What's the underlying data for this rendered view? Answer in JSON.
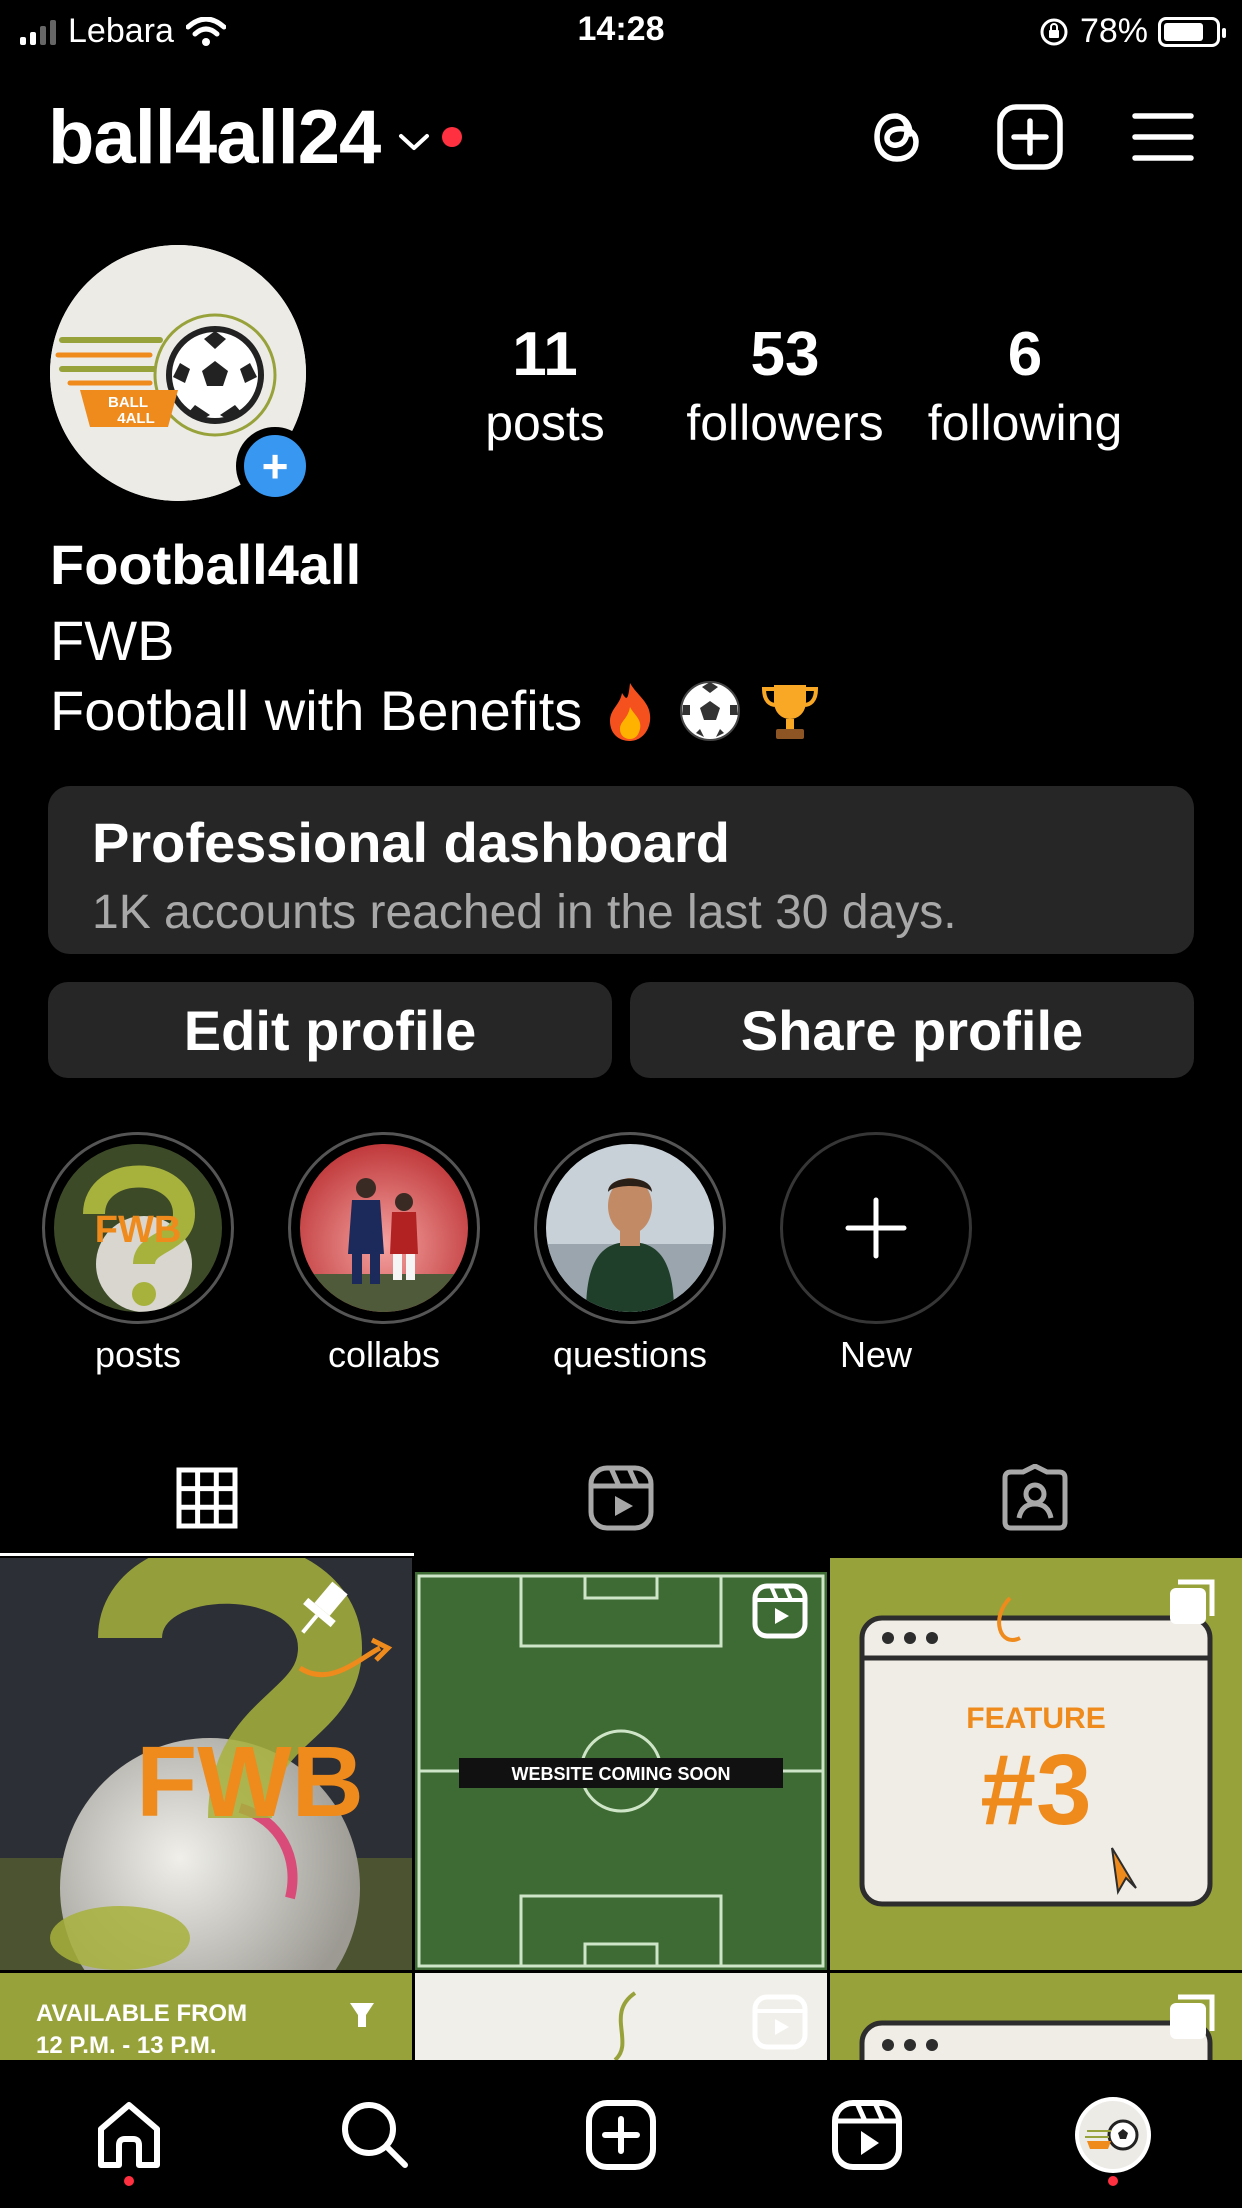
{
  "status_bar": {
    "carrier": "Lebara",
    "time": "14:28",
    "battery": "78%",
    "battery_level": 0.78,
    "icons": [
      "signal-icon",
      "wifi-icon",
      "orientation-lock-icon",
      "battery-icon"
    ]
  },
  "header": {
    "username": "ball4all24",
    "icons": [
      "chevron-down-icon",
      "threads-icon",
      "create-icon",
      "menu-icon"
    ],
    "notification_color": "#ff3040"
  },
  "profile": {
    "logo_text": [
      "BALL",
      "4ALL"
    ],
    "stats": [
      {
        "value": "11",
        "label": "posts"
      },
      {
        "value": "53",
        "label": "followers"
      },
      {
        "value": "6",
        "label": "following"
      }
    ],
    "name": "Football4all",
    "bio_line1": "FWB",
    "bio_line2": "Football with Benefits",
    "bio_emojis": [
      "fire-emoji",
      "soccer-ball-emoji",
      "trophy-emoji"
    ]
  },
  "dashboard": {
    "title": "Professional dashboard",
    "subtitle": "1K accounts reached in the last 30 days."
  },
  "buttons": {
    "edit": "Edit profile",
    "share": "Share profile"
  },
  "highlights": [
    {
      "label": "posts",
      "cover_text": "FWB"
    },
    {
      "label": "collabs"
    },
    {
      "label": "questions"
    },
    {
      "label": "New"
    }
  ],
  "tabs": [
    "grid-icon",
    "reels-icon",
    "tagged-icon"
  ],
  "grid": {
    "post1_text": "FWB",
    "post2_text": "WEBSITE COMING SOON",
    "post3_text_small": "FEATURE",
    "post3_text_big": "#3",
    "post4_text_line1": "AVAILABLE FROM",
    "post4_text_line2": "12 P.M. - 13 P.M."
  },
  "bottom_nav": [
    "home-icon",
    "search-icon",
    "create-icon",
    "reels-icon",
    "profile-avatar"
  ],
  "colors": {
    "accent_blue": "#3897f0",
    "brand_olive": "#98a23a",
    "brand_orange": "#ef8a1c",
    "button_bg": "#262626"
  }
}
